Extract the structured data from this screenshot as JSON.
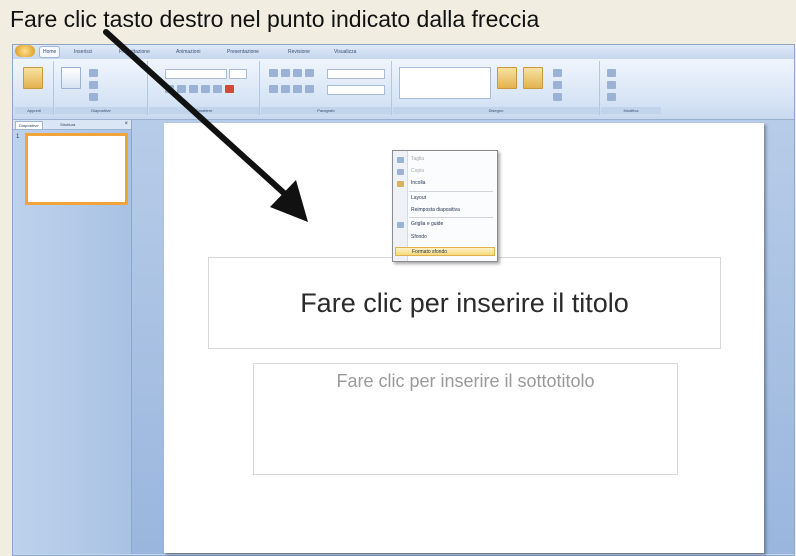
{
  "instruction": "Fare clic tasto destro nel punto indicato dalla freccia",
  "ribbon_tabs": [
    "Home",
    "Inserisci",
    "Progettazione",
    "Animazioni",
    "Presentazione",
    "Revisione",
    "Visualizza"
  ],
  "ribbon_groups": [
    "Appunti",
    "Diapositive",
    "Carattere",
    "Paragrafo",
    "Disegno",
    "Modifica"
  ],
  "left_pane": {
    "tabs": [
      "Diapositive",
      "Struttura"
    ],
    "close": "×",
    "slide_number": "1"
  },
  "slide": {
    "title_placeholder": "Fare clic per inserire il titolo",
    "subtitle_placeholder": "Fare clic per inserire il sottotitolo"
  },
  "context_menu": {
    "items": [
      "Taglia",
      "Copia",
      "Incolla",
      "Layout",
      "Reimposta diapositiva",
      "Griglia e guide",
      "Sfondo",
      "Formato sfondo"
    ],
    "disabled": [
      true,
      true,
      false,
      false,
      false,
      false,
      false,
      false
    ],
    "highlighted_index": 7
  },
  "colors": {
    "accent": "#f0a43a",
    "ribbon": "#d6e4f5",
    "arrow": "#111111"
  }
}
